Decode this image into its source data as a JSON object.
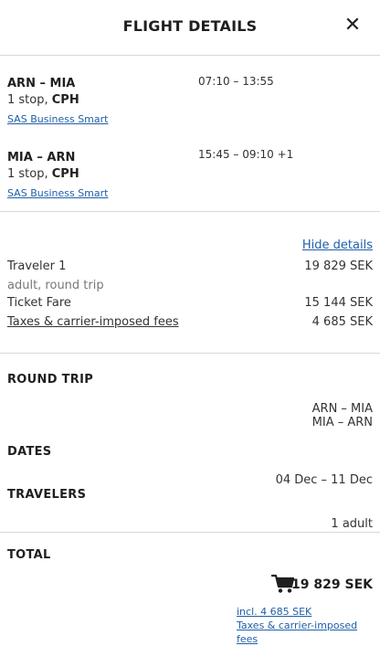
{
  "header": {
    "title": "FLIGHT DETAILS",
    "close_icon": "close-icon"
  },
  "segments": [
    {
      "route": "ARN – MIA",
      "time": "07:10 – 13:55",
      "stops": "1 stop, ",
      "via": "CPH",
      "fare": "SAS Business Smart"
    },
    {
      "route": "MIA – ARN",
      "time": "15:45 – 09:10 +1",
      "stops": "1 stop, ",
      "via": "CPH",
      "fare": "SAS Business Smart"
    }
  ],
  "pricing": {
    "hide_details": "Hide details",
    "traveler_label": "Traveler 1",
    "traveler_amount": "19 829 SEK",
    "traveler_type": "adult, round trip",
    "ticket_label": "Ticket Fare",
    "ticket_amount": "15 144 SEK",
    "taxes_label": "Taxes & carrier-imposed fees",
    "taxes_amount": "4 685 SEK"
  },
  "summary": {
    "trip_label": "ROUND TRIP",
    "trip_route_1": "ARN – MIA",
    "trip_route_2": "MIA – ARN",
    "dates_label": "DATES",
    "dates_value": "04 Dec – 11 Dec",
    "travelers_label": "TRAVELERS",
    "travelers_value": "1 adult"
  },
  "total": {
    "label": "TOTAL",
    "amount": "19 829 SEK",
    "incl": "incl. 4 685 SEK",
    "incl_fees": "Taxes & carrier-imposed fees",
    "cart_icon": "cart-icon"
  }
}
